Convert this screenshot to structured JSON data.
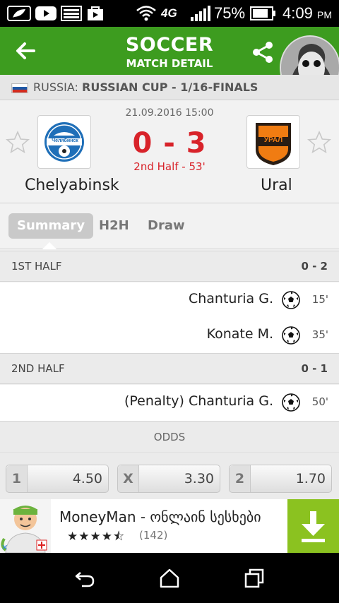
{
  "status_bar": {
    "battery": "75%",
    "network": "4G",
    "time": "4:09",
    "ampm": "PM"
  },
  "header": {
    "title": "SOCCER",
    "subtitle": "MATCH DETAIL"
  },
  "tournament": {
    "country": "RUSSIA:",
    "competition": "RUSSIAN CUP - 1/16-FINALS"
  },
  "match": {
    "datetime": "21.09.2016 15:00",
    "score": "0 - 3",
    "status": "2nd Half - 53'",
    "home_team": "Chelyabinsk",
    "away_team": "Ural",
    "home_logo_text": "Челябинск",
    "away_logo_text": "УРАЛ"
  },
  "tabs": [
    {
      "label": "Summary",
      "active": true
    },
    {
      "label": "H2H",
      "active": false
    },
    {
      "label": "Draw",
      "active": false
    }
  ],
  "halves": [
    {
      "label": "1ST HALF",
      "score": "0 - 2",
      "events": [
        {
          "player": "Chanturia G.",
          "minute": "15'"
        },
        {
          "player": "Konate M.",
          "minute": "35'"
        }
      ]
    },
    {
      "label": "2ND HALF",
      "score": "0 - 1",
      "events": [
        {
          "player": "(Penalty) Chanturia G.",
          "minute": "50'"
        }
      ]
    }
  ],
  "odds": {
    "title": "ODDS",
    "items": [
      {
        "label": "1",
        "value": "4.50"
      },
      {
        "label": "X",
        "value": "3.30"
      },
      {
        "label": "2",
        "value": "1.70"
      }
    ]
  },
  "ad": {
    "title": "MoneyMan - ონლაინ სესხები",
    "stars": "★★★★⯪",
    "count": "(142)"
  },
  "colors": {
    "header_green": "#3d9c1f",
    "score_red": "#d8232a",
    "ad_download_green": "#8bc220"
  }
}
